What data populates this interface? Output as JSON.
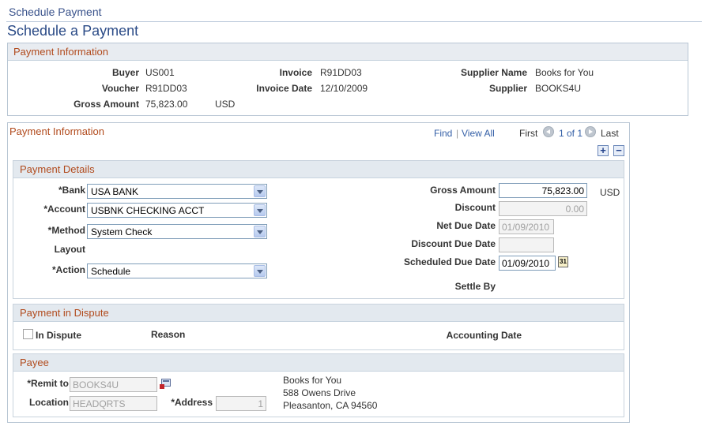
{
  "breadcrumb": "Schedule Payment",
  "page_title": "Schedule a Payment",
  "info_section": {
    "header": "Payment Information",
    "buyer_label": "Buyer",
    "buyer": "US001",
    "voucher_label": "Voucher",
    "voucher": "R91DD03",
    "gross_label": "Gross Amount",
    "gross": "75,823.00",
    "currency": "USD",
    "invoice_label": "Invoice",
    "invoice": "R91DD03",
    "invoice_date_label": "Invoice Date",
    "invoice_date": "12/10/2009",
    "supplier_name_label": "Supplier Name",
    "supplier_name": "Books for You",
    "supplier_label": "Supplier",
    "supplier": "BOOKS4U"
  },
  "payment_section": {
    "header": "Payment Information",
    "find": "Find",
    "sep": "|",
    "view_all": "View All",
    "first": "First",
    "count": "1 of 1",
    "last": "Last",
    "add": "+",
    "remove": "−"
  },
  "details": {
    "header": "Payment Details",
    "bank_label": "*Bank",
    "bank": "USA BANK",
    "account_label": "*Account",
    "account": "USBNK CHECKING ACCT",
    "method_label": "*Method",
    "method": "System Check",
    "layout_label": "Layout",
    "action_label": "*Action",
    "action": "Schedule",
    "gross_label": "Gross Amount",
    "gross": "75,823.00",
    "currency": "USD",
    "discount_label": "Discount",
    "discount": "0.00",
    "net_due_label": "Net Due Date",
    "net_due": "01/09/2010",
    "discount_due_label": "Discount Due Date",
    "discount_due": "",
    "scheduled_due_label": "Scheduled Due Date",
    "scheduled_due": "01/09/2010",
    "calendar_glyph": "31",
    "settle_by_label": "Settle By"
  },
  "dispute": {
    "header": "Payment in Dispute",
    "in_dispute_label": "In Dispute",
    "reason_label": "Reason",
    "accounting_date_label": "Accounting Date"
  },
  "payee": {
    "header": "Payee",
    "remit_label": "*Remit to",
    "remit": "BOOKS4U",
    "location_label": "Location",
    "location": "HEADQRTS",
    "address_label": "*Address",
    "address": "1",
    "address_lines": [
      "Books for You",
      "588 Owens Drive",
      "Pleasanton, CA  94560"
    ]
  }
}
